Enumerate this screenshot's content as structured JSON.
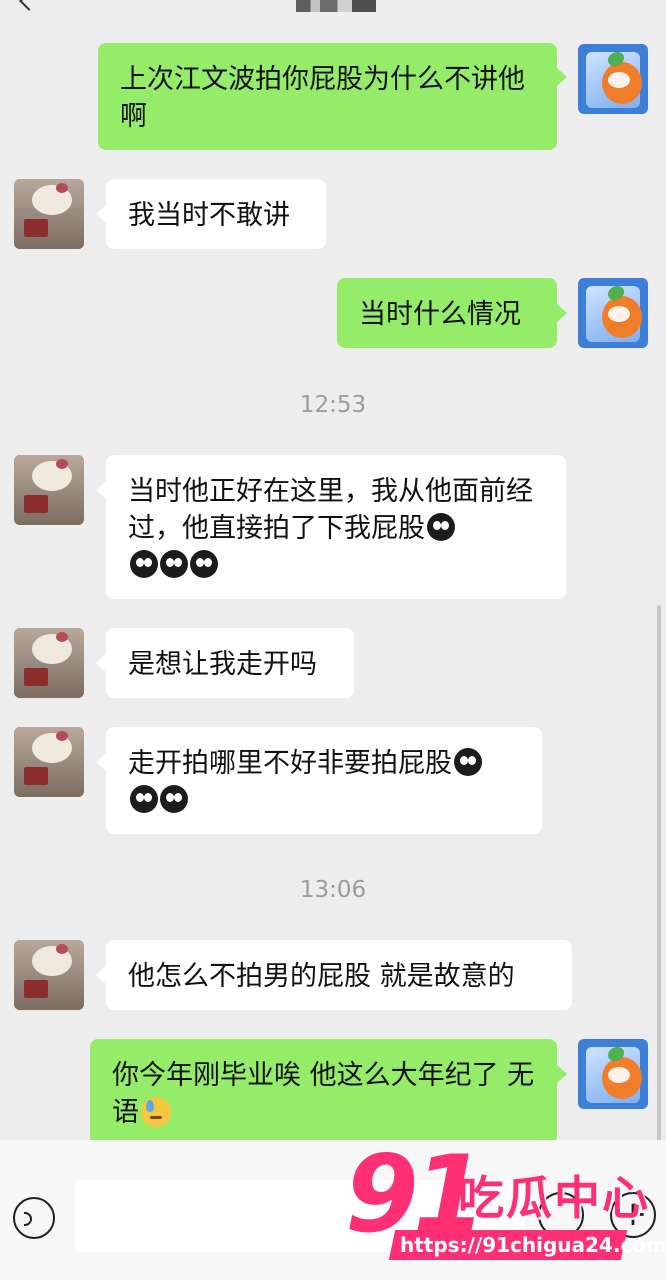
{
  "messages": [
    {
      "id": "m1",
      "from": "me",
      "text": "上次江文波拍你屁股为什么不讲他啊"
    },
    {
      "id": "m2",
      "from": "them",
      "text": "我当时不敢讲"
    },
    {
      "id": "m3",
      "from": "me",
      "text": "当时什么情况"
    },
    {
      "id": "m4",
      "from": "them",
      "text": "当时他正好在这里，我从他面前经过，他直接拍了下我屁股",
      "emoji": "eyes-sweat-face x4"
    },
    {
      "id": "m5",
      "from": "them",
      "text": "是想让我走开吗"
    },
    {
      "id": "m6",
      "from": "them",
      "text": "走开拍哪里不好非要拍屁股",
      "emoji": "eyes-sweat-face x3"
    },
    {
      "id": "m7",
      "from": "them",
      "text": "他怎么不拍男的屁股 就是故意的"
    },
    {
      "id": "m8",
      "from": "me",
      "text": "你今年刚毕业唉 他这么大年纪了 无语",
      "emoji": "downcast-sweat-face"
    }
  ],
  "timestamps": [
    "12:53",
    "13:06"
  ],
  "colors": {
    "my_bubble": "#95ec69",
    "their_bubble": "#ffffff",
    "background": "#ededed",
    "watermark": "#ff2f74"
  },
  "watermark": {
    "number": "91",
    "name": "吃瓜中心",
    "url": "https://91chigua24.com"
  },
  "input_bar": {
    "voice_icon": "voice-icon",
    "emoji_icon": "emoji-icon",
    "plus_icon": "plus-icon"
  }
}
